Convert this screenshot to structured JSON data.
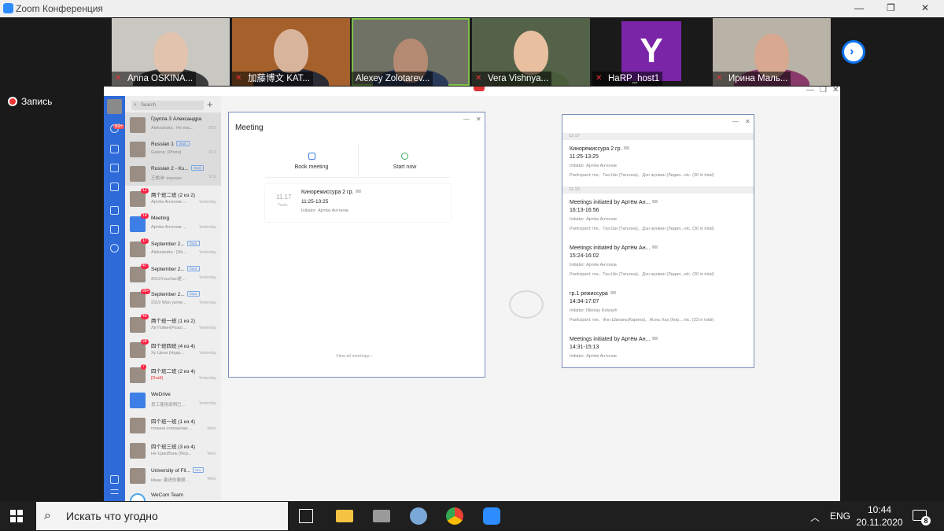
{
  "window": {
    "title": "Zoom Конференция"
  },
  "participants": [
    {
      "name": "Anna OSKINA...",
      "muted": true
    },
    {
      "name": "加藤博文 KAT...",
      "muted": true
    },
    {
      "name": "Alexey Zolotarev...",
      "muted": false,
      "active": true
    },
    {
      "name": "Vera Vishnya...",
      "muted": true
    },
    {
      "name": "HaRP_host1",
      "muted": true,
      "logo": "Y"
    },
    {
      "name": "Ирина Маль...",
      "muted": true
    }
  ],
  "recording_label": "Запись",
  "wecom": {
    "search_placeholder": "Search",
    "chats": [
      {
        "name": "Группа 3 Александра",
        "sub": "Aleksandra : Но пис...",
        "time": "9/22",
        "badge": "",
        "dept": ""
      },
      {
        "name": "Russian 1",
        "sub": "Gaiane: [Photo]",
        "time": "9/13",
        "badge": "",
        "dept": "Dept."
      },
      {
        "name": "Russian 2 - Ks...",
        "sub": "王愉洲: хорошо",
        "time": "9/11",
        "badge": "",
        "dept": "Dept."
      },
      {
        "name": "两个班二班 (2 из 2)",
        "sub": "Артём Антонов:...",
        "time": "Yesterday",
        "badge": "12",
        "dept": ""
      },
      {
        "name": "Meeting",
        "sub": "Артём Антонов ...",
        "time": "Yesterday",
        "badge": "18",
        "dept": "",
        "blue": true
      },
      {
        "name": "September 2...",
        "sub": "Aleksandra : [Sti...",
        "time": "Yesterday",
        "badge": "17",
        "dept": "Dept."
      },
      {
        "name": "September 2...",
        "sub": "2019Yuuchan是...",
        "time": "Yesterday",
        "badge": "47",
        "dept": "Dept."
      },
      {
        "name": "September 2...",
        "sub": "2319 Wan yume...",
        "time": "Yesterday",
        "badge": "99+",
        "dept": "Dept."
      },
      {
        "name": "两个班一班 (1 из 2)",
        "sub": "Ли Пэйин(Роза)...",
        "time": "Yesterday",
        "badge": "40",
        "dept": ""
      },
      {
        "name": "四个班四班 (4 из 4)",
        "sub": "Ху Цена (Надя...",
        "time": "Yesterday",
        "badge": "28",
        "dept": ""
      },
      {
        "name": "四个班二班 (2 из 4)",
        "sub": "[Draft]",
        "time": "Yesterday",
        "badge": "7",
        "dept": ""
      },
      {
        "name": "WeDrive",
        "sub": "员工使用说明已...",
        "time": "Yesterday",
        "badge": "",
        "dept": "",
        "blue": true
      },
      {
        "name": "四个班一班 (1 из 4)",
        "sub": "полина степанова:...",
        "time": "Wed.",
        "badge": "",
        "dept": ""
      },
      {
        "name": "四个班三班 (3 из 4)",
        "sub": "Не ЦзаоВэнь (Вер...",
        "time": "Wed.",
        "badge": "",
        "dept": ""
      },
      {
        "name": "University of Fil...",
        "sub": "Иван: 姜语你要顾...",
        "time": "Wed.",
        "badge": "",
        "dept": "ALL"
      },
      {
        "name": "WeCom Team",
        "sub": "",
        "time": "",
        "badge": "",
        "dept": ""
      }
    ],
    "rail_badge": "99+"
  },
  "meeting_dialog": {
    "title": "Meeting",
    "book_label": "Book meeting",
    "start_label": "Start now",
    "card": {
      "date": "11.17",
      "weekday": "Tues.",
      "title": "Кинорежиссура 2 гр.",
      "time": "11:25-13:25",
      "initiator": "Initiator: Артём Антонов"
    },
    "view_all": "View all meetings ›"
  },
  "schedule_dialog": {
    "groups": [
      {
        "date": "11-17",
        "items": [
          {
            "title": "Кинорежиссура 2 гр.",
            "time": "11:25-13:25",
            "initiator": "Initiator: Артём Антонов",
            "participants": "Participant: me、Тан Ши (Татьяна)、Дэн жунван (Лидия...etc. (30 in total)"
          }
        ]
      },
      {
        "date": "11-13",
        "items": [
          {
            "title": "Meetings initiated by Артём Ан...",
            "time": "16:13-16:56",
            "initiator": "Initiator: Артём Антонов",
            "participants": "Participant: me、Тан Ши (Татьяна)、Дэн жунван (Лидия...etc. (30 in total)"
          },
          {
            "title": "Meetings initiated by Артём Ан...",
            "time": "15:24-16:02",
            "initiator": "Initiator: Артём Антонов",
            "participants": "Participant: me、Тан Ши (Татьяна)、Дэн жунван (Лидия...etc. (30 in total)"
          },
          {
            "title": "гр.1 режиссура",
            "time": "14:34-17:07",
            "initiator": "Initiator: Nikolay Kotyash",
            "participants": "Participant: me、Фэн Шиоань(Карина)、Жэнь Хао (Кир... etc. (33 in total)"
          },
          {
            "title": "Meetings initiated by Артём Ан...",
            "time": "14:31-15:13",
            "initiator": "Initiator: Артём Антонов",
            "participants": ""
          }
        ]
      }
    ]
  },
  "taskbar": {
    "search_placeholder": "Искать что угодно",
    "lang": "ENG",
    "time": "10:44",
    "date": "20.11.2020",
    "notifications": "8"
  },
  "colors": {
    "zoom_blue": "#2d8cff",
    "wecom_blue": "#2e6ad8",
    "badge_red": "#f24444",
    "active_green": "#7fc24a"
  }
}
